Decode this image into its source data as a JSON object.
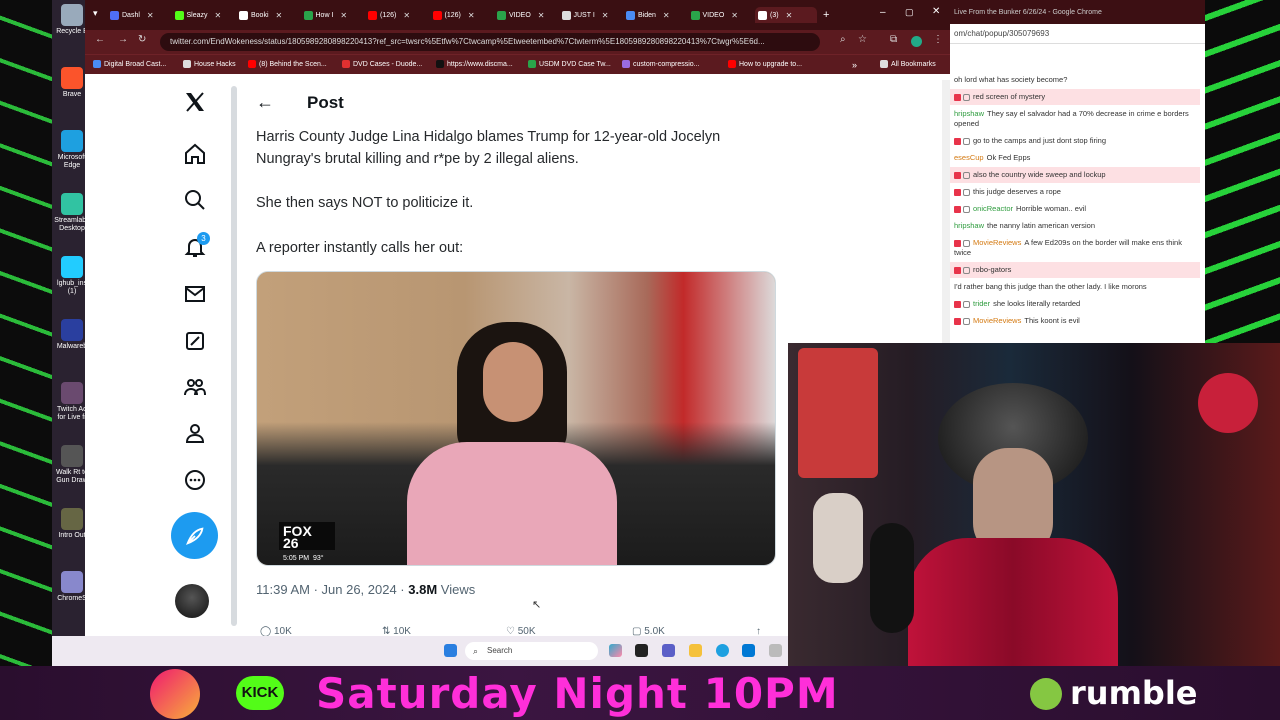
{
  "browser": {
    "tabs": [
      {
        "label": "Dashl",
        "color": "#4f6ef5"
      },
      {
        "label": "Sleazy",
        "color": "#53fc18"
      },
      {
        "label": "Booki",
        "color": "#ffffff"
      },
      {
        "label": "How I",
        "color": "#2aa34a"
      },
      {
        "label": "(126)",
        "color": "#ff0000"
      },
      {
        "label": "(126)",
        "color": "#ff0000"
      },
      {
        "label": "VIDEO",
        "color": "#2aa34a"
      },
      {
        "label": "JUST I",
        "color": "#dddddd"
      },
      {
        "label": "Biden",
        "color": "#4a8cf5"
      },
      {
        "label": "VIDEO",
        "color": "#2aa34a"
      },
      {
        "label": "(3)",
        "color": "#ffffff"
      }
    ],
    "new_tab": "+",
    "url": "twitter.com/EndWokeness/status/1805989280898220413?ref_src=twsrc%5Etfw%7Ctwcamp%5Etweetembed%7Ctwterm%5E1805989280898220413%7Ctwgr%5E6d...",
    "bookmarks": [
      {
        "label": "Digital Broad Cast...",
        "color": "#4a8cf5"
      },
      {
        "label": "House Hacks",
        "color": "#dddddd"
      },
      {
        "label": "(8) Behind the Scen...",
        "color": "#ff0000"
      },
      {
        "label": "DVD Cases - Duode...",
        "color": "#e03030"
      },
      {
        "label": "https://www.discma...",
        "color": "#111111"
      },
      {
        "label": "USDM DVD Case Tw...",
        "color": "#2aa34a"
      },
      {
        "label": "custom-compressio...",
        "color": "#9a6be0"
      },
      {
        "label": "How to upgrade to...",
        "color": "#ff0000"
      }
    ],
    "all_bookmarks": "All Bookmarks"
  },
  "desktop": {
    "icons": [
      {
        "label": "Recycle B",
        "color": "#9ab"
      },
      {
        "label": "Brave",
        "color": "#fb542b"
      },
      {
        "label": "Microsoft Edge",
        "color": "#1ea0e0"
      },
      {
        "label": "Streamlabs Desktop",
        "color": "#31c3a2"
      },
      {
        "label": "lghub_ins (1)",
        "color": "#22ccff"
      },
      {
        "label": "Malwareb",
        "color": "#2a3f9f"
      },
      {
        "label": "Twitch Ad for Live fr",
        "color": "#6a4a6f"
      },
      {
        "label": "Walk Rt to Gun Draw",
        "color": "#555"
      },
      {
        "label": "Intro Out",
        "color": "#664"
      },
      {
        "label": "ChromeS",
        "color": "#88c"
      }
    ]
  },
  "x": {
    "page_title": "Post",
    "notification_count": "3",
    "paragraphs": [
      "Harris County Judge Lina Hidalgo blames Trump for 12-year-old Jocelyn Nungray's brutal killing and r*pe by 2 illegal aliens.",
      "She then says NOT to politicize it.",
      "A reporter instantly calls her out:"
    ],
    "media": {
      "channel": "FOX 26",
      "time": "5:05 PM",
      "temp": "93°"
    },
    "timestamp": "11:39 AM · Jun 26, 2024 · ",
    "views_count": "3.8M",
    "views_label": " Views",
    "actions": [
      "10K",
      "10K",
      "50K",
      "5.0K"
    ]
  },
  "chat": {
    "window_title": "Live From the Bunker 6/26/24 - Google Chrome",
    "url": "om/chat/popup/305079693",
    "messages": [
      {
        "user": "",
        "text": "oh lord what has society become?",
        "hl": false,
        "tags": false
      },
      {
        "user": "",
        "text": "red screen of mystery",
        "hl": true,
        "tags": true
      },
      {
        "user": "hripshaw",
        "text": "They say el salvador had a 70% decrease in crime e borders opened",
        "hl": false,
        "tags": false
      },
      {
        "user": "",
        "text": "go to the camps and just dont stop firing",
        "hl": false,
        "tags": true
      },
      {
        "user": "esesCup",
        "text": "Ok Fed Epps",
        "hl": false,
        "tags": false,
        "orange": true
      },
      {
        "user": "",
        "text": "also the country wide sweep and lockup",
        "hl": true,
        "tags": true
      },
      {
        "user": "",
        "text": "this judge deserves a rope",
        "hl": false,
        "tags": true
      },
      {
        "user": "onicReactor",
        "text": "Horrible woman.. evil",
        "hl": false,
        "tags": true
      },
      {
        "user": "hripshaw",
        "text": "the nanny latin american version",
        "hl": false,
        "tags": false
      },
      {
        "user": "MovieReviews",
        "text": "A few Ed209s on the border will make ens think twice",
        "hl": false,
        "tags": true,
        "orange": true
      },
      {
        "user": "",
        "text": "robo-gators",
        "hl": true,
        "tags": true
      },
      {
        "user": "",
        "text": "I'd rather bang this judge than the other lady. I like morons",
        "hl": false,
        "tags": false
      },
      {
        "user": "trider",
        "text": "she looks literally retarded",
        "hl": false,
        "tags": true
      },
      {
        "user": "MovieReviews",
        "text": "This koont is evil",
        "hl": false,
        "tags": true,
        "orange": true
      }
    ]
  },
  "taskbar": {
    "search_placeholder": "Search"
  },
  "banner": {
    "text": "Saturday Night 10PM",
    "kick": "KICK",
    "rumble": "rumble"
  }
}
